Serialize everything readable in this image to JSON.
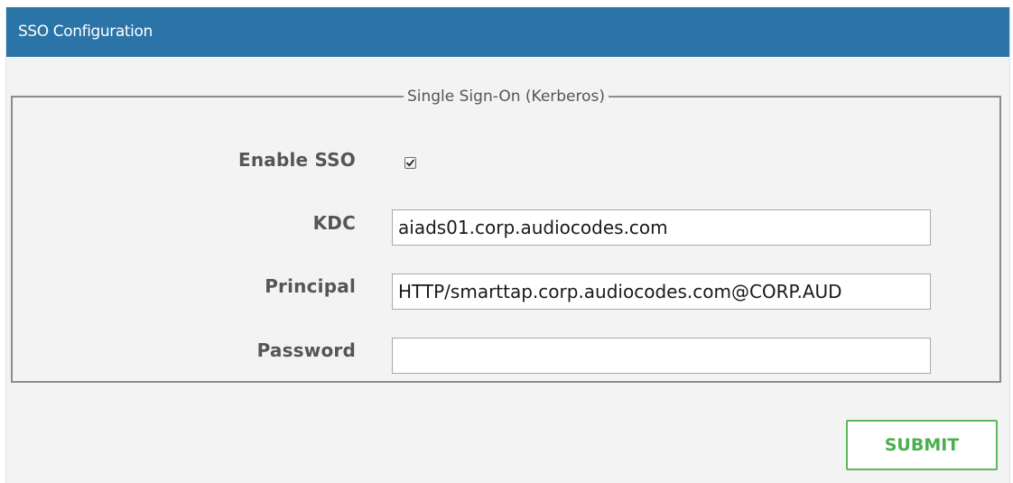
{
  "header": {
    "title": "SSO Configuration"
  },
  "fieldset": {
    "legend": "Single Sign-On (Kerberos)",
    "enable_sso": {
      "label": "Enable SSO",
      "checked": true
    },
    "kdc": {
      "label": "KDC",
      "value": "aiads01.corp.audiocodes.com"
    },
    "principal": {
      "label": "Principal",
      "value": "HTTP/smarttap.corp.audiocodes.com@CORP.AUD"
    },
    "password": {
      "label": "Password",
      "value": ""
    }
  },
  "actions": {
    "submit_label": "SUBMIT"
  },
  "colors": {
    "header_bg": "#2b74a8",
    "panel_bg": "#f3f3f3",
    "submit_accent": "#5cb85c",
    "label_text": "#555555"
  },
  "icons": {
    "checkbox_mark": "checkmark-icon"
  }
}
